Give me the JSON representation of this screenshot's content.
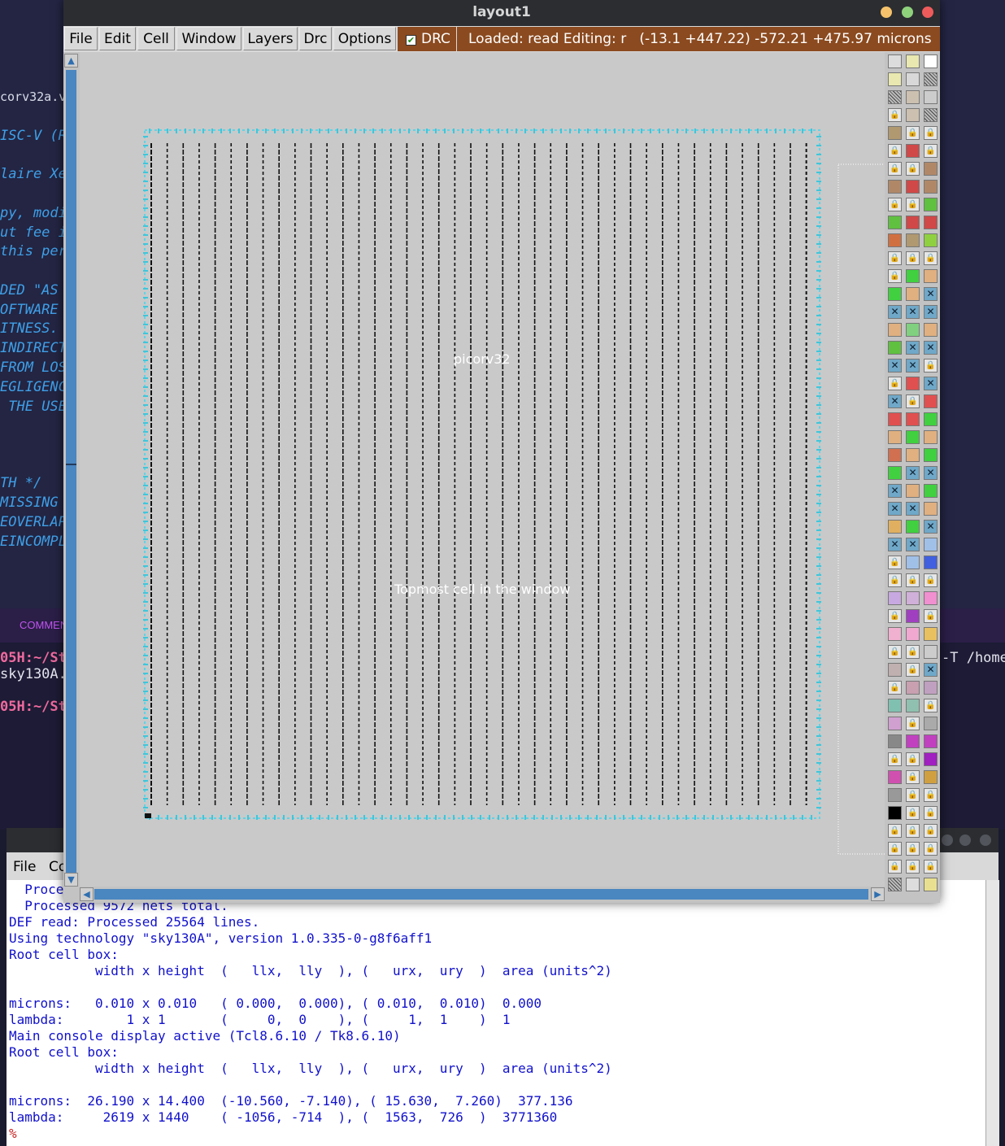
{
  "editor": {
    "file_name": "corv32a.v",
    "code_lines": [
      "ISC-V (R",
      "laire Xe",
      "py, modi",
      "ut fee i",
      "this per",
      "DED \"AS",
      "OFTWARE",
      "ITNESS.",
      "INDIRECT",
      "FROM LOS",
      "EGLIGENC",
      " THE USE",
      "TH */",
      "MISSING",
      "EOVERLAP",
      "EINCOMPL"
    ]
  },
  "status_bar": {
    "label": "COMMEN"
  },
  "terminal": {
    "lines": [
      {
        "prompt": "05H:~/St",
        "right": "-T /home"
      },
      {
        "text": "sky130A."
      },
      {
        "prompt": "05H:~/St"
      }
    ]
  },
  "console": {
    "menu": [
      "File",
      "Co"
    ],
    "lines": [
      "  Proce",
      "  Processed 9572 nets total.",
      "DEF read: Processed 25564 lines.",
      "Using technology \"sky130A\", version 1.0.335-0-g8f6aff1",
      "Root cell box:",
      "           width x height  (   llx,  lly  ), (   urx,  ury  )  area (units^2)",
      "",
      "microns:   0.010 x 0.010   ( 0.000,  0.000), ( 0.010,  0.010)  0.000",
      "lambda:        1 x 1       (     0,  0    ), (     1,  1    )  1",
      "Main console display active (Tcl8.6.10 / Tk8.6.10)",
      "Root cell box:",
      "           width x height  (   llx,  lly  ), (   urx,  ury  )  area (units^2)",
      "",
      "microns:  26.190 x 14.400  (-10.560, -7.140), ( 15.630,  7.260)  377.136",
      "lambda:     2619 x 1440    ( -1056, -714  ), (  1563,  726  )  3771360",
      "%"
    ]
  },
  "layout_window": {
    "title": "layout1",
    "menu": [
      "File",
      "Edit",
      "Cell",
      "Window",
      "Layers",
      "Drc",
      "Options"
    ],
    "drc_label": "DRC",
    "drc_checked": true,
    "status_text": "Loaded: read Editing: r   (-13.1 +447.22) -572.21 +475.97 microns",
    "cell_name": "picorv32",
    "cell_caption": "Topmost cell in the window",
    "status_color": "#8b4a1f",
    "scroll_color": "#4a86c0"
  }
}
